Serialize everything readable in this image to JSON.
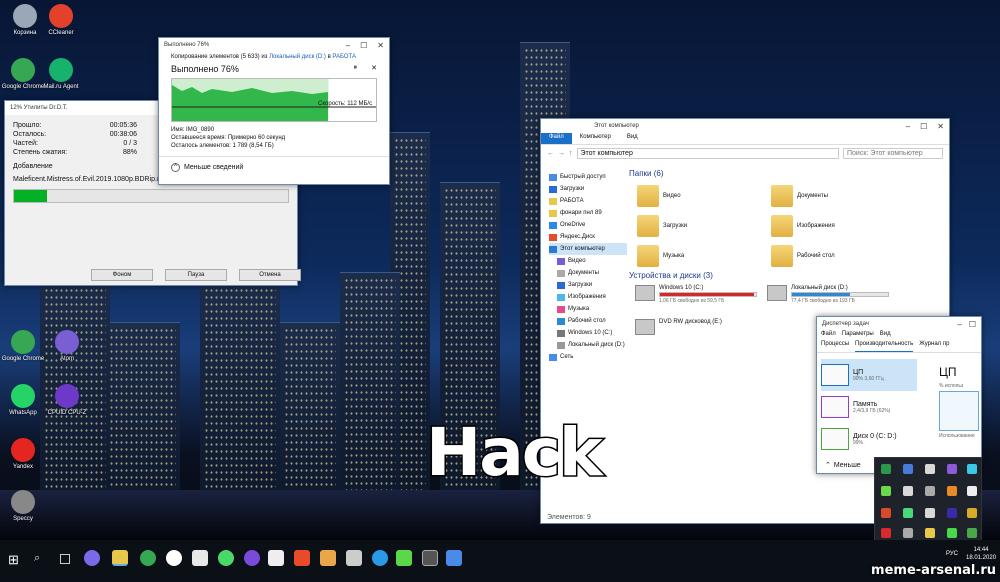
{
  "desktop": {
    "icons": [
      {
        "label": "Корзина",
        "color": "#9aa7b6"
      },
      {
        "label": "CCleaner",
        "color": "#e4412d"
      },
      {
        "label": "Google Chrome",
        "color": "#36a853"
      },
      {
        "label": "Mail.ru Agent",
        "color": "#17b26b"
      },
      {
        "label": "Google Chrome",
        "color": "#36a853"
      },
      {
        "label": "Atom",
        "color": "#7a5fd4"
      },
      {
        "label": "WhatsApp",
        "color": "#25d366"
      },
      {
        "label": "CPUID CPU-Z",
        "color": "#6d39c9"
      },
      {
        "label": "Yandex",
        "color": "#e52620"
      },
      {
        "label": "Speccy",
        "color": "#888888"
      }
    ]
  },
  "download": {
    "title": "12% Утилиты Dr.D.T.",
    "rows": [
      {
        "label": "Прошло:",
        "value": "00:05:36"
      },
      {
        "label": "Осталось:",
        "value": "00:38:06"
      },
      {
        "label": "Частей:",
        "value": "0 / 3"
      },
      {
        "label": "Степень сжатия:",
        "value": "88%"
      }
    ],
    "section": "Добавление",
    "file": "Maleficent.Mistress.of.Evil.2019.1080p.BDRip.mkv",
    "progress": 0.12,
    "buttons": [
      "Фоном",
      "Пауза",
      "Отмена"
    ]
  },
  "copy": {
    "title": "Выполнено 76%",
    "line": "Копирование элементов (5 633) из",
    "src": "Локальный диск (D:)",
    "to": "в",
    "dst": "РАБОТА",
    "done": "Выполнено 76%",
    "speed": "Скорость: 112 МБ/с",
    "name_label": "Имя:",
    "name": "IMG_0890",
    "time_label": "Оставшееся время:",
    "time": "Примерно 60 секунд",
    "items_label": "Осталось элементов:",
    "items": "1 789 (8,54 ГБ)",
    "less": "Меньше сведений",
    "progress": 0.76
  },
  "explorer": {
    "title": "Этот компьютер",
    "tabs": [
      "Файл",
      "Компьютер",
      "Вид"
    ],
    "address": "Этот компьютер",
    "search": "Поиск: Этот компьютер",
    "nav": [
      "Быстрый доступ",
      "Загрузки",
      "РАБОТА",
      "фонари пнл 89",
      "OneDrive",
      "Яндекс.Диск",
      "Этот компьютер",
      "Видео",
      "Документы",
      "Загрузки",
      "Изображения",
      "Музыка",
      "Рабочий стол",
      "Windows 10 (C:)",
      "Локальный диск (D:)",
      "Сеть"
    ],
    "folders_header": "Папки (6)",
    "folders": [
      "Видео",
      "Документы",
      "Загрузки",
      "Изображения",
      "Музыка",
      "Рабочий стол"
    ],
    "devices_header": "Устройства и диски (3)",
    "drives": [
      {
        "name": "Windows 10 (C:)",
        "free": "1,06 ГБ свободно из 59,5 ГБ",
        "fill": 0.98,
        "color": "#d9262a"
      },
      {
        "name": "Локальный диск (D:)",
        "free": "77,4 ГБ свободно из 193 ГБ",
        "fill": 0.6,
        "color": "#2a8ad8"
      },
      {
        "name": "DVD RW дисковод (E:)",
        "free": "",
        "fill": 0,
        "color": "#2a8ad8"
      }
    ],
    "status": "Элементов: 9"
  },
  "taskmgr": {
    "title": "Диспетчер задач",
    "menu": [
      "Файл",
      "Параметры",
      "Вид"
    ],
    "tabs": [
      "Процессы",
      "Производительность",
      "Журнал пр"
    ],
    "items": [
      {
        "name": "ЦП",
        "val": "90% 3,60 ГГц"
      },
      {
        "name": "Память",
        "val": "2,4/3,9 ГБ (62%)"
      },
      {
        "name": "Диск 0 (C: D:)",
        "val": "99%"
      }
    ],
    "big": "ЦП",
    "pct": "% использ",
    "sub": "Использование",
    "less": "Меньше"
  },
  "meme": {
    "caption": "Hack"
  },
  "taskbar": {
    "lang": "РУС",
    "time": "14:44",
    "date": "18.01.2020"
  },
  "watermark": "meme-arsenal.ru"
}
